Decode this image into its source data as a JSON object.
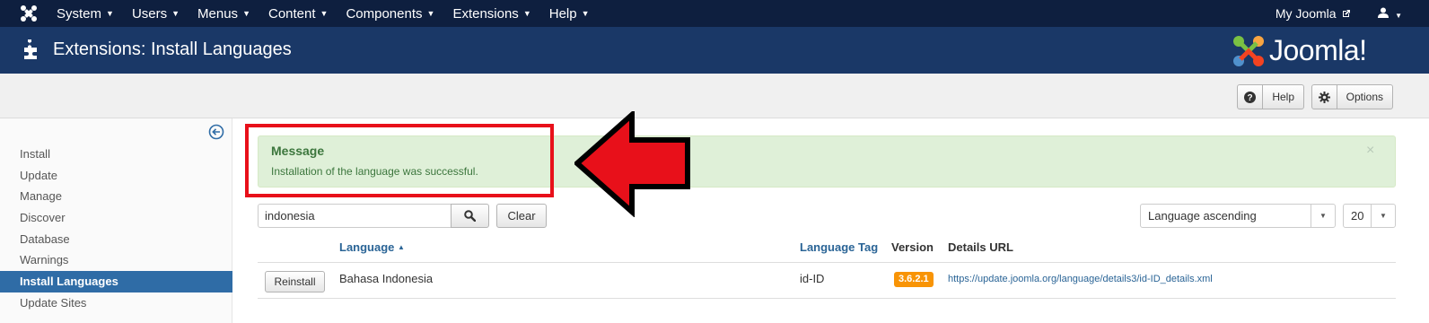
{
  "topnav": {
    "menus": [
      "System",
      "Users",
      "Menus",
      "Content",
      "Components",
      "Extensions",
      "Help"
    ],
    "my_joomla": "My Joomla",
    "user_icon": "user-icon"
  },
  "header": {
    "title": "Extensions: Install Languages",
    "brand": "Joomla!"
  },
  "toolbar": {
    "help_label": "Help",
    "options_label": "Options"
  },
  "sidebar": {
    "items": [
      {
        "label": "Install",
        "active": false
      },
      {
        "label": "Update",
        "active": false
      },
      {
        "label": "Manage",
        "active": false
      },
      {
        "label": "Discover",
        "active": false
      },
      {
        "label": "Database",
        "active": false
      },
      {
        "label": "Warnings",
        "active": false
      },
      {
        "label": "Install Languages",
        "active": true
      },
      {
        "label": "Update Sites",
        "active": false
      }
    ]
  },
  "message": {
    "heading": "Message",
    "text": "Installation of the language was successful.",
    "close": "×"
  },
  "filters": {
    "search_value": "indonesia",
    "clear_label": "Clear",
    "sort_value": "Language ascending",
    "limit_value": "20"
  },
  "table": {
    "columns": {
      "language": "Language",
      "language_tag": "Language Tag",
      "version": "Version",
      "details_url": "Details URL"
    },
    "rows": [
      {
        "action": "Reinstall",
        "language": "Bahasa Indonesia",
        "tag": "id-ID",
        "version": "3.6.2.1",
        "url": "https://update.joomla.org/language/details3/id-ID_details.xml"
      }
    ]
  },
  "colors": {
    "topbar": "#0e1f3f",
    "header": "#1a3867",
    "sidebar_active": "#2f6ca6",
    "alert_bg": "#dff0d8",
    "alert_text": "#3c763d",
    "badge": "#f89406",
    "annotation": "#e8101a"
  }
}
